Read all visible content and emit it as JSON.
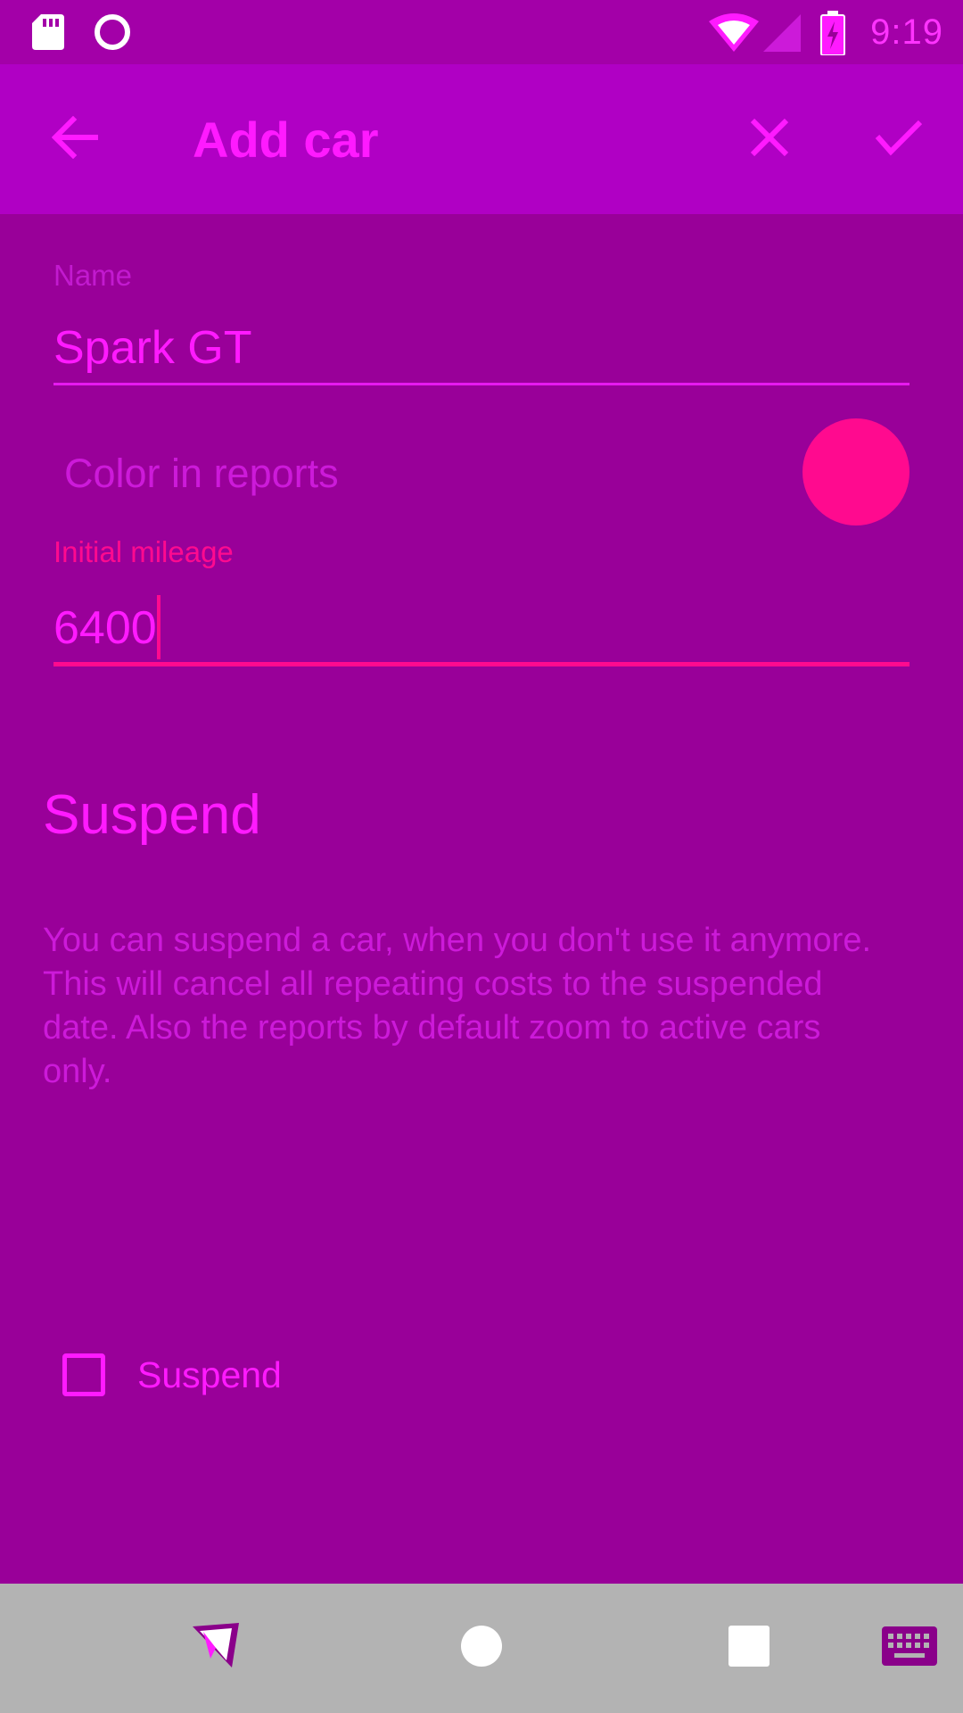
{
  "status_bar": {
    "time": "9:19",
    "icons": [
      "sd-card-icon",
      "sync-circle-icon",
      "wifi-icon",
      "cell-signal-icon",
      "battery-charging-icon"
    ]
  },
  "app_bar": {
    "title": "Add car",
    "back_icon": "arrow-back-icon",
    "close_icon": "close-icon",
    "confirm_icon": "check-icon"
  },
  "form": {
    "name_label": "Name",
    "name_value": "Spark GT",
    "color_label": "Color in reports",
    "color_value": "#ff0a8f",
    "mileage_label": "Initial mileage",
    "mileage_value": "6400"
  },
  "suspend_section": {
    "title": "Suspend",
    "description": "You can suspend a car, when you don't use it anymore. This will cancel all repeating costs to the suspended date. Also the reports by default zoom to active cars only.",
    "checkbox_label": "Suspend",
    "checked": false
  },
  "nav_bar": {
    "buttons": [
      "app-launcher-icon",
      "home-icon",
      "recents-icon",
      "keyboard-icon"
    ]
  },
  "colors": {
    "background": "#990099",
    "status_bar": "#a300a8",
    "app_bar": "#b000c4",
    "accent": "#ff0a8f",
    "primary_text": "#ff1aff",
    "nav_bar": "#b3b3b3"
  }
}
